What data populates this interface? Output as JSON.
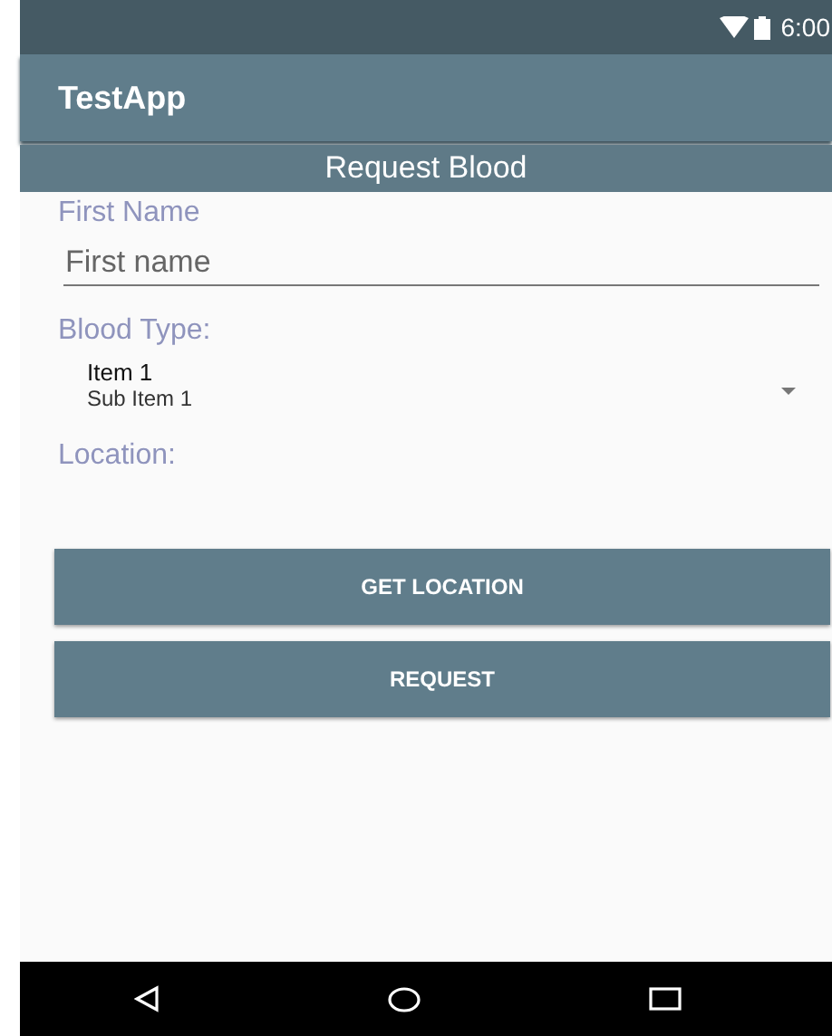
{
  "status_bar": {
    "time": "6:00"
  },
  "toolbar": {
    "title": "TestApp"
  },
  "header": {
    "title": "Request Blood"
  },
  "form": {
    "first_name_label": "First Name",
    "first_name_field": {
      "placeholder": "First name"
    },
    "blood_type_label": "Blood Type:",
    "blood_type_spinner": {
      "item": "Item 1",
      "sub_item": "Sub Item 1"
    },
    "location_label": "Location:"
  },
  "buttons": [
    {
      "label": "GET LOCATION"
    },
    {
      "label": "REQUEST"
    }
  ]
}
